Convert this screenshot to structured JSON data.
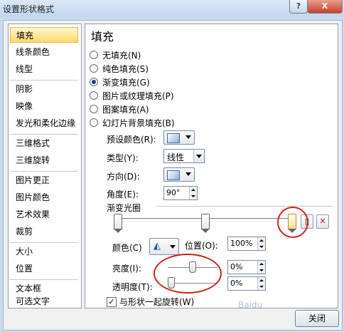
{
  "window": {
    "title": "设置形状格式",
    "help_label": "?",
    "close_label": "X"
  },
  "nav": {
    "items": [
      {
        "label": "填充",
        "selected": true
      },
      {
        "label": "线条颜色"
      },
      {
        "label": "线型"
      },
      {
        "label": "阴影"
      },
      {
        "label": "映像"
      },
      {
        "label": "发光和柔化边缘"
      },
      {
        "label": "三维格式"
      },
      {
        "label": "三维旋转"
      },
      {
        "label": "图片更正"
      },
      {
        "label": "图片颜色"
      },
      {
        "label": "艺术效果"
      },
      {
        "label": "裁剪"
      },
      {
        "label": "大小"
      },
      {
        "label": "位置"
      },
      {
        "label": "文本框"
      },
      {
        "label": "可选文字"
      }
    ]
  },
  "panel": {
    "heading": "填充",
    "fill_options": [
      {
        "label": "无填充(N)",
        "selected": false
      },
      {
        "label": "纯色填充(S)",
        "selected": false
      },
      {
        "label": "渐变填充(G)",
        "selected": true
      },
      {
        "label": "图片或纹理填充(P)",
        "selected": false
      },
      {
        "label": "图案填充(A)",
        "selected": false
      },
      {
        "label": "幻灯片背景填充(B)",
        "selected": false
      }
    ],
    "preset_label": "预设颜色(R):",
    "type_label": "类型(Y):",
    "type_value": "线性",
    "direction_label": "方向(D):",
    "angle_label": "角度(E):",
    "angle_value": "90°",
    "gradient_stops_label": "渐变光圈",
    "gradient_stops_positions": [
      0,
      50,
      100
    ],
    "selected_stop_index": 2,
    "add_stop_icon": "add-gradient-stop-icon",
    "remove_stop_icon": "remove-gradient-stop-icon",
    "color_label": "颜色(C)",
    "color_icon": "paint-bucket-icon",
    "position_label": "位置(O):",
    "position_value": "100%",
    "brightness_label": "亮度(I):",
    "brightness_value": "0%",
    "brightness_level": 0.5,
    "transparency_label": "透明度(T):",
    "transparency_value": "0%",
    "transparency_level": 0.0,
    "rotate_with_shape_label": "与形状一起旋转(W)",
    "rotate_with_shape_checked": true
  },
  "footer": {
    "close_button_label": "关闭"
  },
  "colors": {
    "highlight_ellipse": "#c8241d",
    "selected_nav": "#ffd86b"
  }
}
